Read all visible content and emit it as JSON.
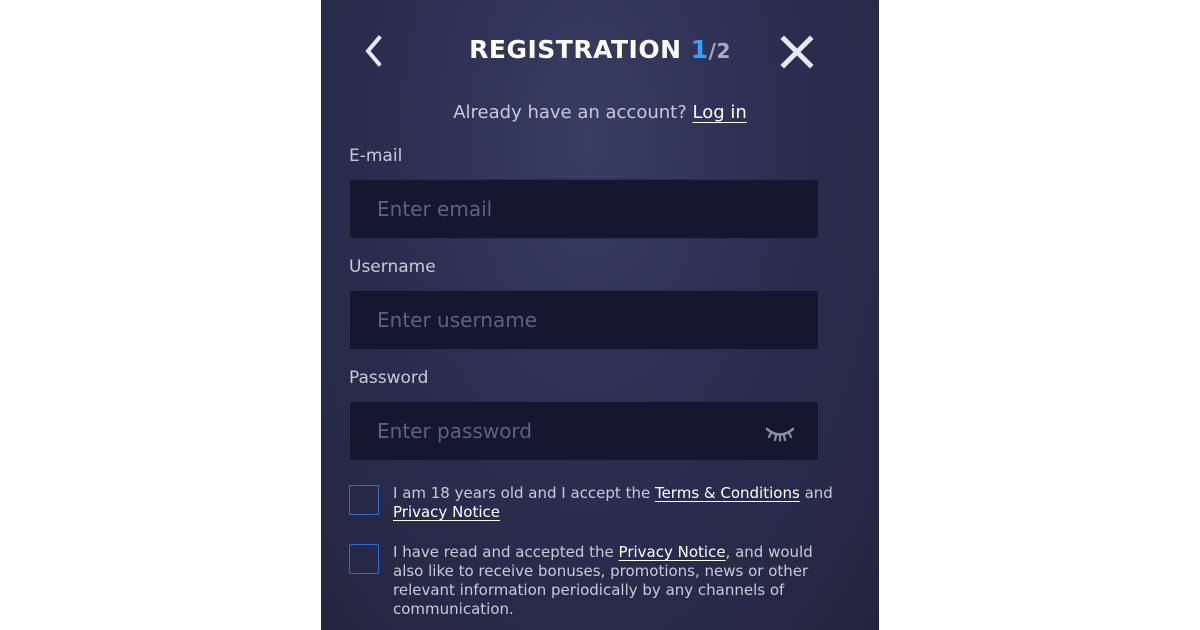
{
  "header": {
    "title": "REGISTRATION",
    "step_current": "1",
    "step_separator": "/",
    "step_total": "2"
  },
  "login": {
    "prompt": "Already have an account?",
    "link": "Log in"
  },
  "fields": {
    "email": {
      "label": "E-mail",
      "placeholder": "Enter email",
      "value": ""
    },
    "username": {
      "label": "Username",
      "placeholder": "Enter username",
      "value": ""
    },
    "password": {
      "label": "Password",
      "placeholder": "Enter password",
      "value": ""
    }
  },
  "consents": {
    "age": {
      "text_before": "I am 18 years old and I accept the",
      "terms_link": "Terms & Conditions",
      "text_middle": "and",
      "privacy_link": "Privacy Notice",
      "checked": false
    },
    "marketing": {
      "text_before": "I have read and accepted the",
      "privacy_link": "Privacy Notice",
      "text_after": ", and would also like to receive bonuses, promotions, news or other relevant information periodically by any channels of communication.",
      "checked": false
    }
  },
  "icons": {
    "back": "chevron-left-icon",
    "close": "close-icon",
    "password_toggle": "eye-closed-icon"
  },
  "colors": {
    "accent": "#2ea3ff",
    "checkbox_border": "#2e6bd6",
    "modal_bg": "#2c2e52",
    "field_bg": "#151730"
  }
}
